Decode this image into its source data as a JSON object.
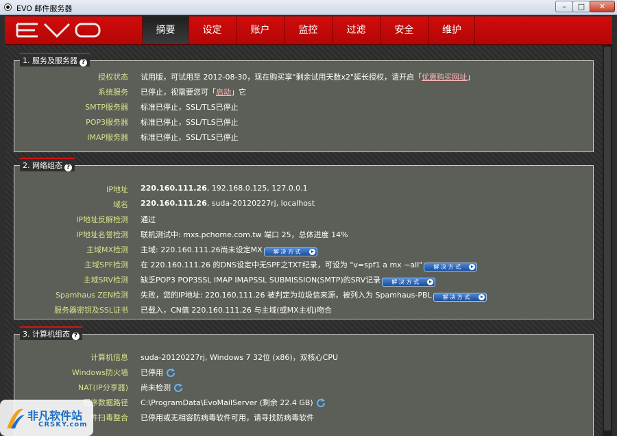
{
  "window": {
    "title": "EVO 邮件服务器",
    "min_label": "–",
    "max_label": "□",
    "close_label": "✕"
  },
  "nav": {
    "logo_text": "EVO",
    "tabs": [
      {
        "label": "摘要",
        "active": true
      },
      {
        "label": "设定"
      },
      {
        "label": "账户"
      },
      {
        "label": "监控"
      },
      {
        "label": "过滤"
      },
      {
        "label": "安全"
      },
      {
        "label": "维护"
      }
    ]
  },
  "section1": {
    "title": "1. 服务及服务器",
    "rows": [
      {
        "label": "授权状态",
        "value_prefix": "试用版，可试用至 2012-08-30，现在购买享\"剩余试用天数x2\"延长授权，请开启「",
        "link": "优惠购买网址",
        "value_suffix": "」"
      },
      {
        "label": "系统服务",
        "value_prefix": "已停止，视需要您可「",
        "link": "启动",
        "value_suffix": "」它"
      },
      {
        "label": "SMTP服务器",
        "value": "标准已停止，SSL/TLS已停止"
      },
      {
        "label": "POP3服务器",
        "value": "标准已停止，SSL/TLS已停止"
      },
      {
        "label": "IMAP服务器",
        "value": "标准已停止，SSL/TLS已停止"
      }
    ]
  },
  "section2": {
    "title": "2. 网络组态",
    "rows": [
      {
        "label": "IP地址",
        "bold": "220.160.111.26",
        "value": ", 192.168.0.125, 127.0.0.1"
      },
      {
        "label": "域名",
        "bold": "220.160.111.26",
        "value": ", suda-20120227rj, localhost"
      },
      {
        "label": "IP地址反解检测",
        "value": "通过"
      },
      {
        "label": "IP地址名誉检测",
        "value": "联机测试中: mxs.pchome.com.tw 端口 25，总体进度 14%"
      },
      {
        "label": "主域MX检测",
        "value": "主域: 220.160.111.26尚未设定MX"
      },
      {
        "label": "主域SPF检测",
        "value": "在 220.160.111.26 的DNS设定中无SPF之TXT纪录，可设为 \"v=spf1 a mx ~all\""
      },
      {
        "label": "主域SRV检测",
        "value": "缺乏POP3 POP3SSL IMAP IMAPSSL SUBMISSION(SMTP)的SRV记录"
      },
      {
        "label": "Spamhaus ZEN检测",
        "value": "失败，您的IP地址: 220.160.111.26 被判定为垃圾信来源，被列入为 Spamhaus-PBL"
      },
      {
        "label": "服务器密钥及SSL证书",
        "value": "已载入，CN值 220.160.111.26 与主域(或MX主机)吻合"
      }
    ],
    "solution_label": "解 决 方 式"
  },
  "section3": {
    "title": "3. 计算机组态",
    "rows": [
      {
        "label": "计算机信息",
        "value": "suda-20120227rj, Windows 7 32位 (x86)，双核心CPU"
      },
      {
        "label": "Windows防火墙",
        "value": "已停用"
      },
      {
        "label": "NAT(IP分享器)",
        "value": "尚未检测"
      },
      {
        "label": "程序数据路径",
        "value": "C:\\ProgramData\\EvoMailServer (剩余 22.4 GB)"
      },
      {
        "label": "件扫毒整合",
        "value": "已停用或无相容防病毒软件可用，请寻找防病毒软件"
      }
    ]
  },
  "watermark": {
    "line1": "非凡软件站",
    "line2": "CRSKY.com"
  },
  "colors": {
    "label": "#d6e28a",
    "nav_red": "#c00808",
    "panel": "#5c5e58",
    "link": "#ffb5b5"
  }
}
